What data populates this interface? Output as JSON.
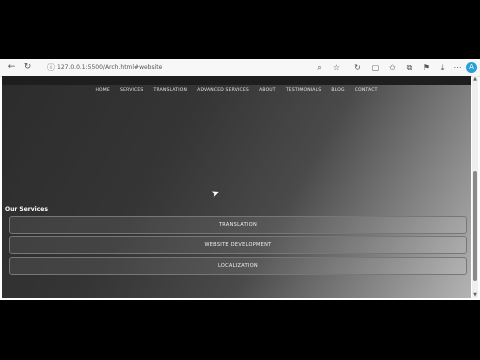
{
  "browser": {
    "url": "127.0.0.1:5500/Arch.html#website",
    "toolbar_icons": [
      "back-icon",
      "refresh-icon",
      "lock-icon",
      "zoom-icon",
      "star-icon",
      "reader-icon",
      "split-icon",
      "favorites-icon",
      "collections-icon",
      "extensions-icon",
      "downloads-icon",
      "profile-icon"
    ],
    "avatar_initial": "A"
  },
  "nav": {
    "items": [
      "HOME",
      "SERVICES",
      "TRANSLATION",
      "ADVANCED SERVICES",
      "ABOUT",
      "TESTIMONIALS",
      "BLOG",
      "CONTACT"
    ]
  },
  "services": {
    "heading": "Our Services",
    "items": [
      "TRANSLATION",
      "WEBSITE DEVELOPMENT",
      "LOCALIZATION"
    ]
  }
}
